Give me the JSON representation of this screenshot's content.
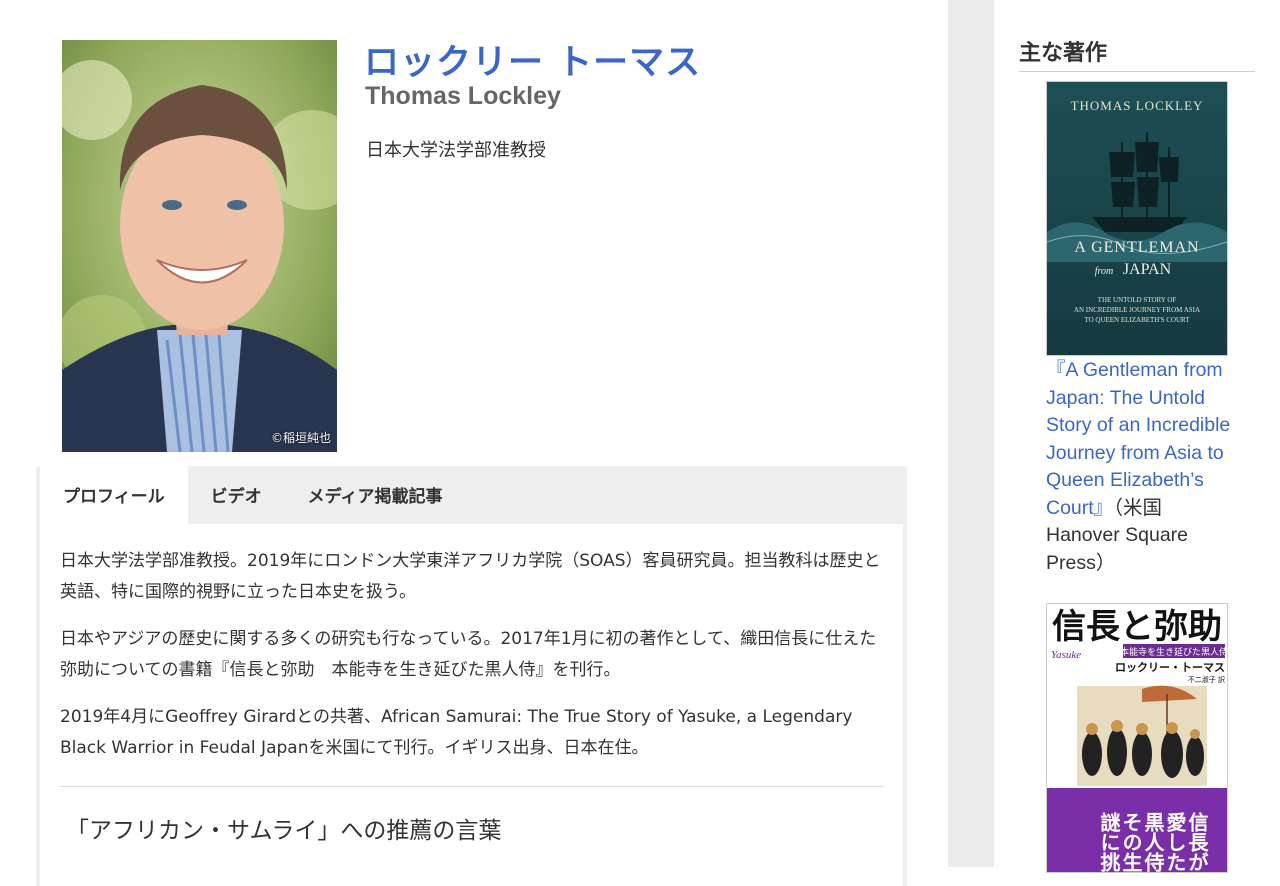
{
  "profile": {
    "name_ja": "ロックリー トーマス",
    "name_en": "Thomas Lockley",
    "position": "日本大学法学部准教授",
    "photo_credit": "©稲垣純也"
  },
  "tabs": [
    {
      "label": "プロフィール",
      "active": true
    },
    {
      "label": "ビデオ",
      "active": false
    },
    {
      "label": "メディア掲載記事",
      "active": false
    }
  ],
  "content": {
    "paragraphs": [
      "日本大学法学部准教授。2019年にロンドン大学東洋アフリカ学院（SOAS）客員研究員。担当教科は歴史と英語、特に国際的視野に立った日本史を扱う。",
      "日本やアジアの歴史に関する多くの研究も行なっている。2017年1月に初の著作として、織田信長に仕えた弥助についての書籍『信長と弥助　本能寺を生き延びた黒人侍』を刊行。",
      "2019年4月にGeoffrey Girardとの共著、African Samurai: The True Story of Yasuke, a Legendary Black Warrior in Feudal Japanを米国にて刊行。イギリス出身、日本在住。"
    ],
    "subheading": "「アフリカン・サムライ」への推薦の言葉"
  },
  "sidebar": {
    "heading": "主な著作",
    "book1": {
      "cover_author": "THOMAS LOCKLEY",
      "cover_title_1": "A GENTLEMAN",
      "cover_from": "from",
      "cover_title_2": "JAPAN",
      "cover_sub_1": "THE UNTOLD STORY OF",
      "cover_sub_2": "AN INCREDIBLE JOURNEY FROM ASIA",
      "cover_sub_3": "TO QUEEN ELIZABETH'S COURT",
      "link_text": "『A Gentleman from Japan: The Untold Story of an Incredible Journey from Asia to Queen Elizabeth’s Court』",
      "publisher": "（米国 Hanover Square Press）"
    },
    "book2": {
      "cover_title": "信長と弥助",
      "cover_subtitle": "本能寺を生き延びた黒人侍",
      "cover_author": "ロックリー・トーマス",
      "cover_translator": "不二淑子 訳",
      "cover_yasuke": "Yasuke",
      "cover_catch_1": "信長が",
      "cover_catch_2": "愛した",
      "cover_catch_3": "黒人侍",
      "cover_catch_4": "その生涯の",
      "cover_catch_5": "謎に挑む"
    }
  },
  "colors": {
    "accent": "#3a67c4",
    "book1_bg": "#1f4a4e",
    "book2_band": "#7a2fa8"
  }
}
